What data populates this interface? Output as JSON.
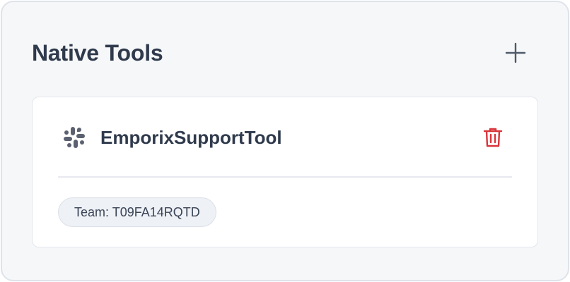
{
  "panel": {
    "title": "Native Tools",
    "add_icon": "plus-icon"
  },
  "tool": {
    "icon": "slack-icon",
    "name": "EmporixSupportTool",
    "delete_icon": "trash-icon",
    "team_label": "Team: T09FA14RQTD"
  },
  "colors": {
    "title": "#2f3a4c",
    "delete": "#d9343a",
    "icon_gray": "#5b6170",
    "badge_bg": "#eef1f6"
  }
}
